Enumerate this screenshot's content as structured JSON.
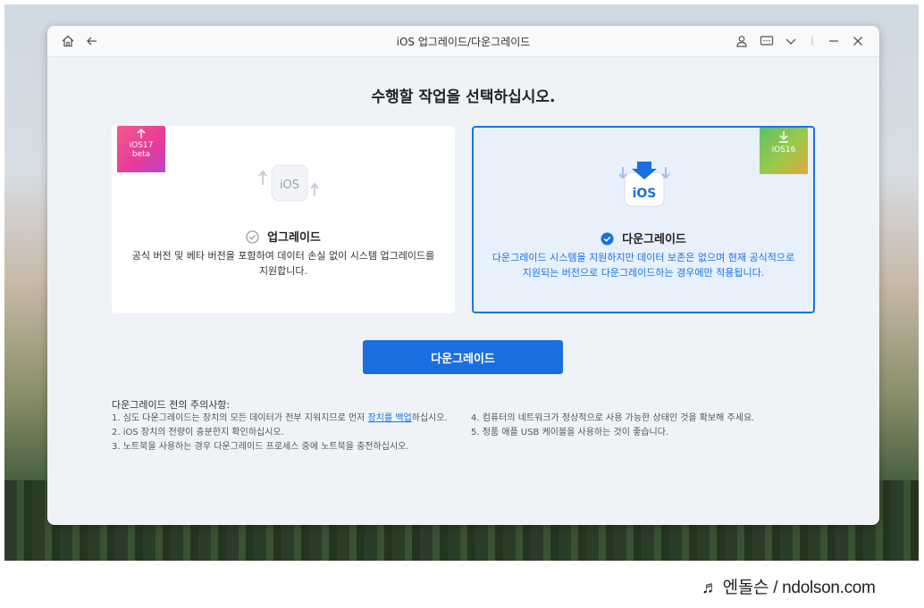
{
  "window": {
    "title": "iOS 업그레이드/다운그레이드"
  },
  "main": {
    "heading": "수행할 작업을 선택하십시오.",
    "cards": [
      {
        "ribbon_line1": "iOS17",
        "ribbon_line2": "beta",
        "icon_label": "iOS",
        "title": "업그레이드",
        "description": "공식 버전 및 베타 버전을 포함하여 데이터 손실 없이 시스템 업그레이드를 지원합니다.",
        "selected": false
      },
      {
        "ribbon_line1": "iOS16",
        "icon_label": "iOS",
        "title": "다운그레이드",
        "description": "다운그레이드 시스템을 지원하지만 데이터 보존은 없으며 현재 공식적으로 지원되는 버전으로 다운그레이드하는 경우에만 적용됩니다.",
        "selected": true
      }
    ],
    "action_button": "다운그레이드"
  },
  "notes": {
    "title": "다운그레이드 전의 주의사항:",
    "item1_before": "1.  심도 다운그레이드는 장치의 모든 데이터가 전부 지워지므로 먼저 ",
    "item1_link": "장치를 백업",
    "item1_after": "하십시오.",
    "item2": "2.  iOS 장치의 전량이 충분한지 확인하십시오.",
    "item3": "3.  노트북을 사용하는 경우 다운그레이드 프로세스 중에 노트북을 충전하십시오.",
    "item4": "4.  컴퓨터의 네트워크가 정상적으로 사용 가능한 상태인 것을 확보해 주세요.",
    "item5": "5.  정품 애플 USB 케이블을 사용하는 것이 좋습니다."
  },
  "watermark": "♬ 엔돌슨 / ndolson.com",
  "colors": {
    "accent": "#1a6fe0",
    "upgrade_ribbon": "#e8458a",
    "downgrade_ribbon": "#7cc35a"
  }
}
